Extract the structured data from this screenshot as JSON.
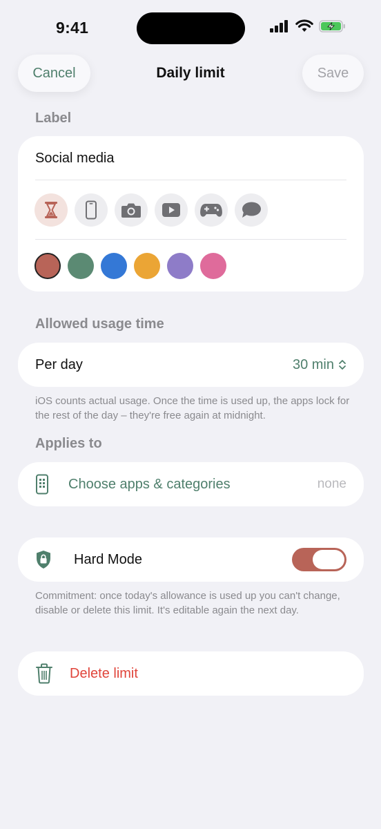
{
  "status_bar": {
    "time": "9:41"
  },
  "nav": {
    "cancel_label": "Cancel",
    "title": "Daily limit",
    "save_label": "Save"
  },
  "label_section": {
    "heading": "Label",
    "value": "Social media",
    "icons": [
      "hourglass-icon",
      "phone-icon",
      "camera-icon",
      "play-icon",
      "gamepad-icon",
      "chat-bubble-icon"
    ],
    "selected_icon": "hourglass-icon",
    "colors": [
      "#b86458",
      "#5b8a73",
      "#3478d6",
      "#eba535",
      "#8e7cc8",
      "#df6b9b"
    ],
    "selected_color": "#b86458"
  },
  "usage_section": {
    "heading": "Allowed usage time",
    "row_label": "Per day",
    "row_value": "30 min",
    "footnote": "iOS counts actual usage. Once the time is used up, the apps lock for the rest of the day – they're free again at midnight."
  },
  "applies_section": {
    "heading": "Applies to",
    "row_label": "Choose apps & categories",
    "row_value": "none"
  },
  "hard_mode": {
    "label": "Hard Mode",
    "enabled": true,
    "footnote": "Commitment: once today's allowance is used up you can't change, disable or delete this limit. It's editable again the next day."
  },
  "delete": {
    "label": "Delete limit"
  },
  "colors": {
    "accent_green": "#4f7f6c",
    "destructive": "#e0443a",
    "toggle_on": "#b86458"
  }
}
